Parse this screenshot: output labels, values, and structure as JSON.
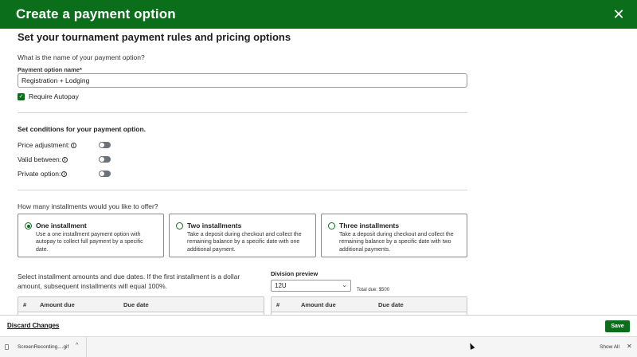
{
  "header": {
    "title": "Create a payment option",
    "close_icon": "✕"
  },
  "form": {
    "section_title": "Set your tournament payment rules and pricing options",
    "name_question": "What is the name of your payment option?",
    "name_label": "Payment option name",
    "required_mark": "*",
    "name_value": "Registration + Lodging",
    "autopay_label": "Require Autopay",
    "autopay_checked": true
  },
  "conditions": {
    "title": "Set conditions for your payment option.",
    "items": [
      {
        "label": "Price adjustment:",
        "enabled": false
      },
      {
        "label": "Valid between:",
        "enabled": false
      },
      {
        "label": "Private option:",
        "enabled": false
      }
    ]
  },
  "installments": {
    "question": "How many installments would you like to offer?",
    "options": [
      {
        "title": "One installment",
        "desc": "Use a one installment payment option with autopay to collect full payment by a specific date.",
        "selected": true
      },
      {
        "title": "Two installments",
        "desc": "Take a deposit during checkout and collect the remaining balance by a specific date with one additional payment.",
        "selected": false
      },
      {
        "title": "Three installments",
        "desc": "Take a deposit during checkout and collect the remaining balance by a specific date with two additional payments.",
        "selected": false
      }
    ],
    "amounts_text": "Select installment amounts and due dates. If the first installment is a dollar amount, subsequent installments will equal 100%.",
    "division_preview_label": "Division preview",
    "division_value": "12U",
    "total_due": "Total due: $500",
    "table_headers": {
      "num": "#",
      "amount": "Amount due",
      "date": "Due date"
    }
  },
  "footer": {
    "discard_label": "Discard Changes",
    "save_label": "Save"
  },
  "downloads": {
    "file_name": "ScreenRecording....gif",
    "show_all": "Show All",
    "close_icon": "✕",
    "chevron": "^"
  },
  "colors": {
    "brand_green": "#0b6e1a",
    "toggle_off": "#6c7278"
  }
}
